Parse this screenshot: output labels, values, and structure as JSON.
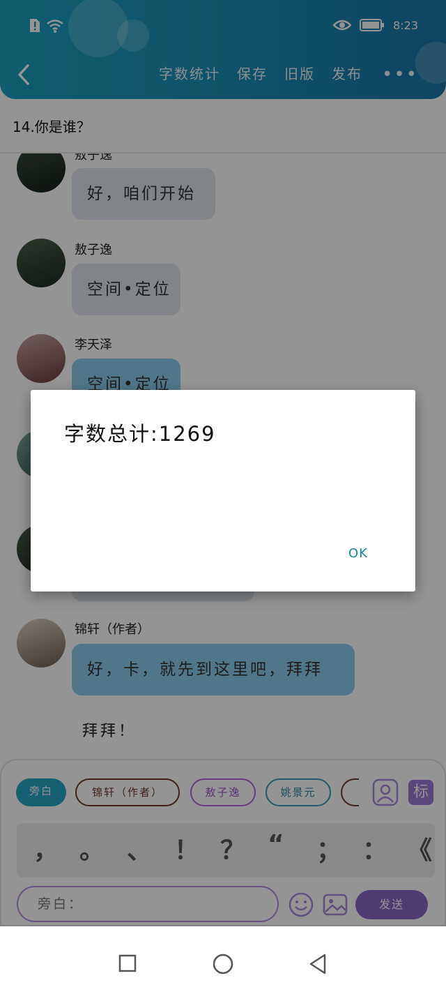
{
  "status_bar": {
    "time": "8:23"
  },
  "toolbar": {
    "word_count": "字数统计",
    "save": "保存",
    "old_version": "旧版",
    "publish": "发布",
    "more": "•••"
  },
  "question": "14.你是谁？",
  "messages": [
    {
      "name": "敖子逸",
      "text": "好，咱们开始",
      "style": "gray"
    },
    {
      "name": "敖子逸",
      "text": "空间•定位",
      "style": "gray"
    },
    {
      "name": "李天泽",
      "text": "空间•定位",
      "style": "blue"
    },
    {
      "name": "锦轩（作者）",
      "text": "好，卡，就先到这里吧，拜拜",
      "style": "blue"
    }
  ],
  "narration": "拜拜！",
  "roles": {
    "narrator": "旁白",
    "author": "锦轩（作者）",
    "aozi": "敖子逸",
    "yao": "姚景元"
  },
  "punctuation": [
    "，",
    "。",
    "、",
    "！",
    "？",
    "“",
    "；",
    "：",
    "《"
  ],
  "input": {
    "placeholder": "旁白："
  },
  "send_label": "发送",
  "dialog": {
    "message": "字数总计:1269",
    "ok": "OK"
  },
  "colors": {
    "header_start": "#1aa0bf",
    "header_end": "#1a76a8",
    "accent_purple": "#8a68c7",
    "dialog_ok": "#178a9c"
  }
}
